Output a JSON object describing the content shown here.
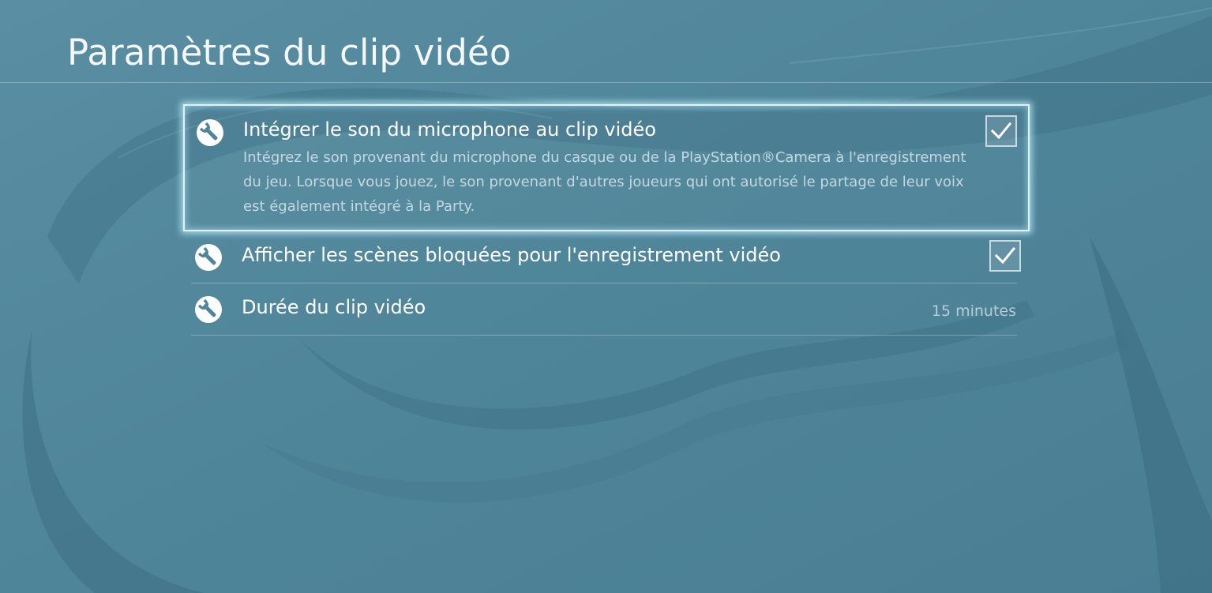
{
  "page": {
    "title": "Paramètres du clip vidéo"
  },
  "settings": [
    {
      "label": "Intégrer le son du microphone au clip vidéo",
      "description": "Intégrez le son provenant du microphone du casque ou de la PlayStation®Camera à l'enregistrement du jeu. Lorsque vous jouez, le son provenant d'autres joueurs qui ont autorisé le partage de leur voix est également intégré à la Party.",
      "icon": "wrench-icon",
      "checked": true,
      "focused": true
    },
    {
      "label": "Afficher les scènes bloquées pour l'enregistrement vidéo",
      "icon": "wrench-icon",
      "checked": true
    },
    {
      "label": "Durée du clip vidéo",
      "value": "15 minutes",
      "icon": "wrench-icon"
    }
  ],
  "colors": {
    "background": "#4f8499",
    "focus_glow": "#bff0ff",
    "text": "#ffffff",
    "text_secondary": "#e2eef3"
  }
}
